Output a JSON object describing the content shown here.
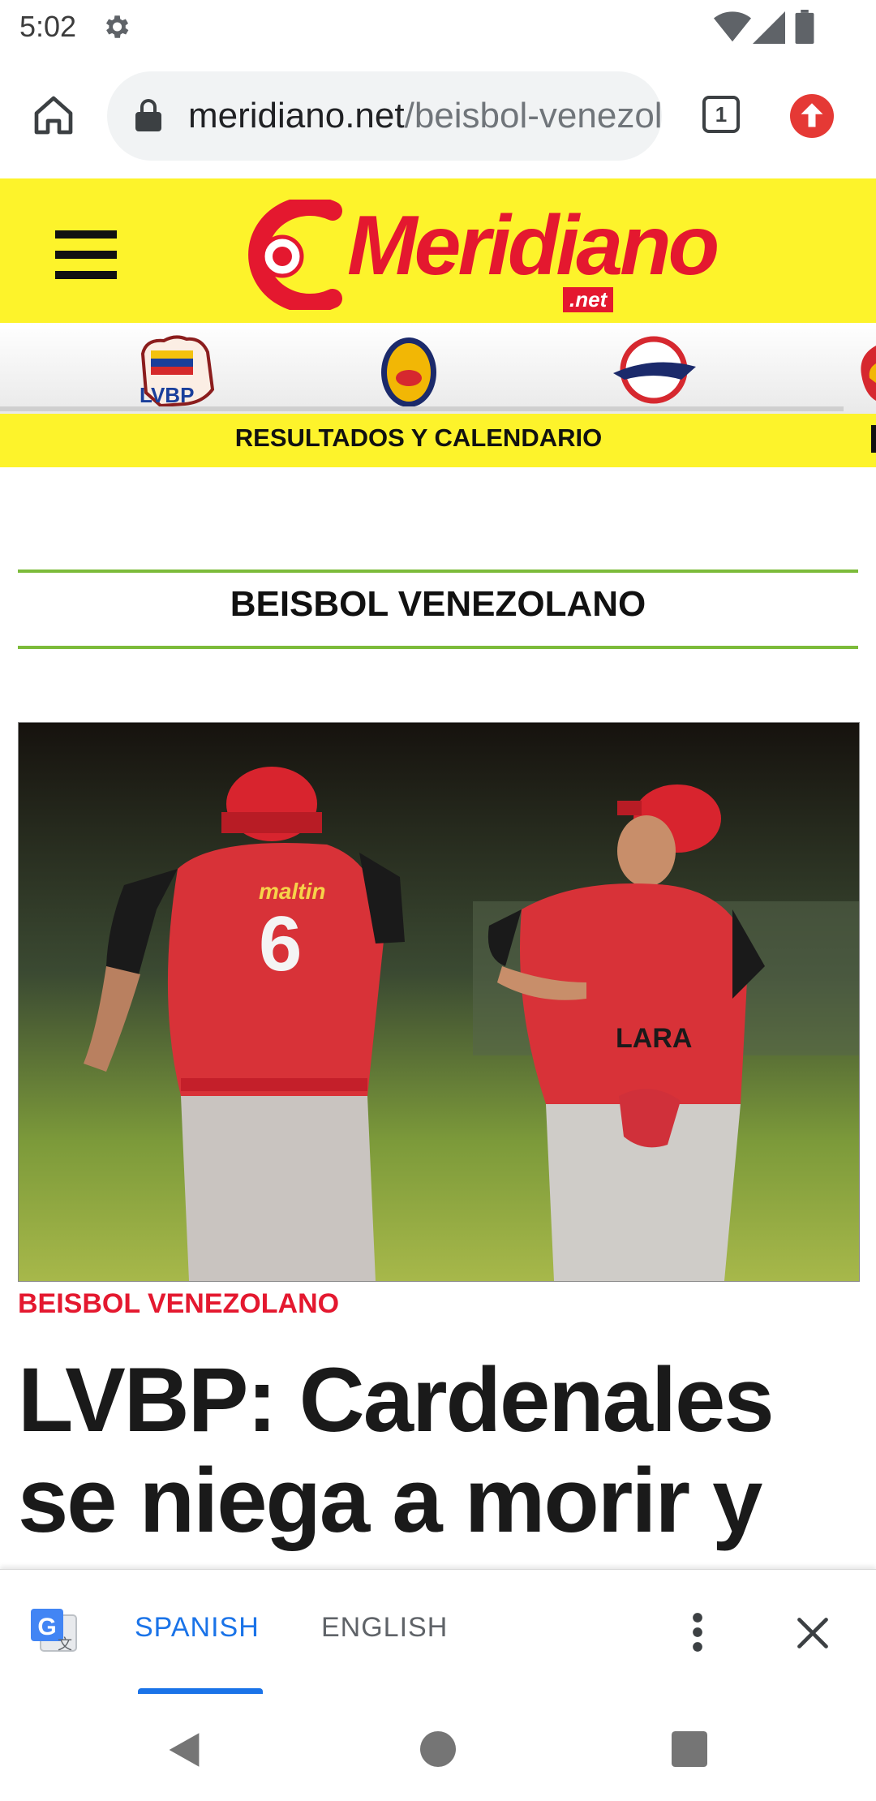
{
  "status_bar": {
    "time": "5:02",
    "icons": [
      "gear-icon",
      "wifi-icon",
      "signal-icon",
      "battery-icon"
    ]
  },
  "browser": {
    "url_domain": "meridiano.net",
    "url_path": "/beisbol-venezolano",
    "tab_count": "1",
    "icons": [
      "home-icon",
      "lock-icon",
      "tabs-icon",
      "update-icon"
    ]
  },
  "site": {
    "logo_text": "Meridiano",
    "logo_suffix": ".net",
    "colors": {
      "brand_yellow": "#fdf32b",
      "brand_red": "#e4182f",
      "section_green": "#7cbb3a"
    }
  },
  "team_strip": {
    "teams": [
      "LVBP",
      "Leones del Caracas",
      "Tiburones de La Guaira",
      "Cardenales de Lara"
    ],
    "lvbp_label": "LVBP",
    "results_label": "RESULTADOS Y CALENDARIO"
  },
  "section": {
    "title": "BEISBOL VENEZOLANO"
  },
  "article": {
    "category": "BEISBOL VENEZOLANO",
    "headline": "LVBP: Cardenales se niega a morir y",
    "photo": {
      "player_left_number": "6",
      "player_left_text": "maltin",
      "player_right_text": "LARA"
    }
  },
  "translate_bar": {
    "source_lang": "SPANISH",
    "target_lang": "ENGLISH",
    "active_color": "#1a73e8"
  },
  "nav_bar": {
    "icons": [
      "back-icon",
      "home-circle-icon",
      "recents-icon"
    ]
  }
}
